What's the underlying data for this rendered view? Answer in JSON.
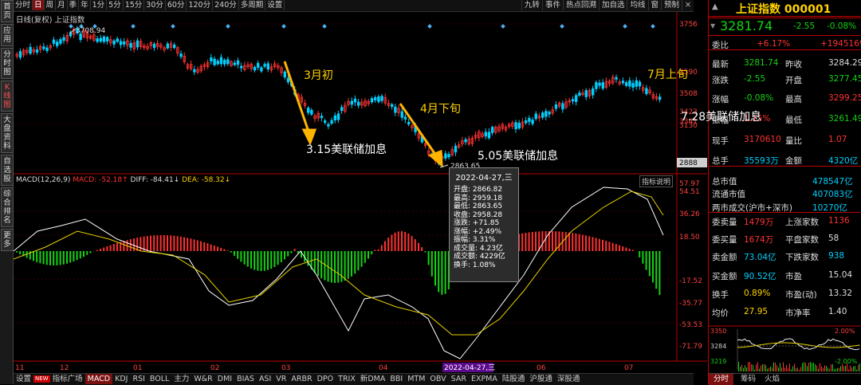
{
  "sidebar": [
    "首页",
    "应用",
    "分时图",
    "K线图",
    "大盘资料",
    "自选股",
    "综合排名",
    "更多"
  ],
  "toolbar_left": [
    "分时",
    "日",
    "周",
    "月",
    "季",
    "年",
    "1分",
    "5分",
    "15分",
    "30分",
    "60分",
    "120分",
    "240分",
    "多周期",
    "设置"
  ],
  "toolbar_left_active": "日",
  "toolbar_right": [
    "九转",
    "事件",
    "热点回溯",
    "加自选",
    "均线",
    "窗",
    "预制"
  ],
  "chart_title": "日线(复权) 上证指数",
  "price_axis": [
    "3756",
    "3590",
    "3508",
    "3423",
    "3341",
    "3130",
    "2888"
  ],
  "price_axis_current": "2888",
  "high_label": "3708.94",
  "low_label": "2863.65",
  "annotations": {
    "mar": "3月初",
    "apr": "4月下旬",
    "jul": "7月上旬",
    "h315": "3.15美联储加息",
    "h505": "5.05美联储加息",
    "h728": "7.28美联储加息"
  },
  "macd_header": {
    "name": "MACD(12,26,9)",
    "macd": "MACD: -52.18↑",
    "diff": "DIFF: -84.41↓",
    "dea": "DEA: -58.32↓",
    "btn": "指标说明"
  },
  "macd_axis": [
    "57.97",
    "54.51",
    "36.26",
    "18.50",
    "-17.52",
    "-35.77",
    "-53.53",
    "-71.79"
  ],
  "x_labels": [
    "11",
    "12",
    "01",
    "02",
    "03",
    "04",
    "2022-04-27,三",
    "06",
    "07"
  ],
  "tooltip": {
    "date": "2022-04-27,三",
    "rows": [
      "开盘: 2866.82",
      "最高: 2959.18",
      "最低: 2863.65",
      "收盘: 2958.28",
      "涨跌: +71.85",
      "涨幅: +2.49%",
      "振幅: 3.31%",
      "成交量: 4.23亿",
      "成交额: 4229亿",
      "换手: 1.08%"
    ]
  },
  "bottom_tabs": [
    "设置",
    "NEW",
    "指标广场",
    "MACD",
    "KDJ",
    "RSI",
    "BOLL",
    "主力",
    "W&R",
    "DMI",
    "BIAS",
    "ASI",
    "VR",
    "ARBR",
    "DPO",
    "TRIX",
    "新DMA",
    "BBI",
    "MTM",
    "OBV",
    "SAR",
    "EXPMA",
    "陆股通",
    "沪股通",
    "深股通"
  ],
  "bottom_active": "MACD",
  "quote": {
    "name": "上证指数 000001",
    "price": "3281.74",
    "change": "-2.55",
    "pct": "-0.08%",
    "rows": [
      [
        "委比",
        "+6.17%",
        "+1945169"
      ],
      [
        "最新",
        "3281.74",
        "昨收",
        "3284.29"
      ],
      [
        "涨跌",
        "-2.55",
        "开盘",
        "3277.45"
      ],
      [
        "涨幅",
        "-0.08%",
        "最高",
        "3299.25"
      ],
      [
        "振幅",
        "1.15%",
        "最低",
        "3261.49"
      ],
      [
        "现手",
        "3170610",
        "量比",
        "1.07"
      ],
      [
        "总手",
        "35593万",
        "金额",
        "4320亿"
      ],
      [
        "总市值",
        "478547亿"
      ],
      [
        "流通市值",
        "407083亿"
      ],
      [
        "两市成交(沪市+深市)",
        "10270亿"
      ],
      [
        "委卖量",
        "1479万",
        "上涨家数",
        "1136"
      ],
      [
        "委买量",
        "1674万",
        "平盘家数",
        "58"
      ],
      [
        "卖金额",
        "73.04亿",
        "下跌家数",
        "938"
      ],
      [
        "买金额",
        "90.52亿",
        "市盈",
        "15.04"
      ],
      [
        "换手",
        "0.89%",
        "市盈(动)",
        "13.32"
      ],
      [
        "均价",
        "27.95",
        "市净率",
        "1.40"
      ]
    ],
    "mini_axis": [
      "3350",
      "3284",
      "3219"
    ],
    "mini_pct": [
      "2.00%",
      "-2.00%"
    ],
    "tabs": [
      "分时",
      "筹码",
      "火焰"
    ]
  },
  "colors": {
    "up": "#ff3232",
    "down": "#00d0ff",
    "accent": "#ffd200",
    "panel_border": "#b00000"
  }
}
